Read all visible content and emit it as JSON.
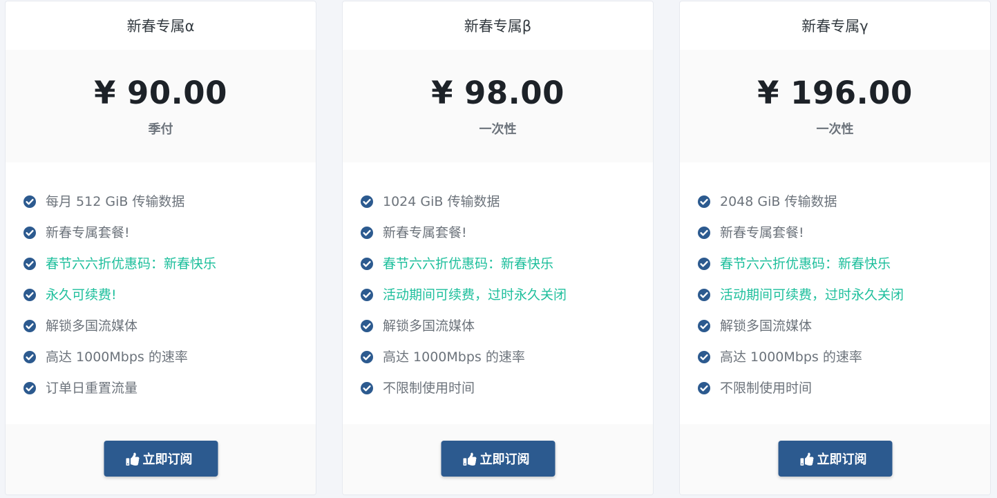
{
  "colors": {
    "accent": "#2c5a8f",
    "highlight": "#1ebf9c",
    "text_muted": "#6c737b",
    "price": "#1d2228"
  },
  "plans": [
    {
      "title": "新春专属α",
      "price": "¥ 90.00",
      "period": "季付",
      "features": [
        {
          "text": "每月 512 GiB 传输数据",
          "highlight": false
        },
        {
          "text": "新春专属套餐!",
          "highlight": false
        },
        {
          "text": "春节六六折优惠码：新春快乐",
          "highlight": true
        },
        {
          "text": "永久可续费!",
          "highlight": true
        },
        {
          "text": "解锁多国流媒体",
          "highlight": false
        },
        {
          "text": "高达 1000Mbps 的速率",
          "highlight": false
        },
        {
          "text": "订单日重置流量",
          "highlight": false
        }
      ],
      "button": {
        "label": "立即订阅",
        "icon": "thumbs-up-icon"
      }
    },
    {
      "title": "新春专属β",
      "price": "¥ 98.00",
      "period": "一次性",
      "features": [
        {
          "text": "1024 GiB 传输数据",
          "highlight": false
        },
        {
          "text": "新春专属套餐!",
          "highlight": false
        },
        {
          "text": "春节六六折优惠码：新春快乐",
          "highlight": true
        },
        {
          "text": "活动期间可续费，过时永久关闭",
          "highlight": true
        },
        {
          "text": "解锁多国流媒体",
          "highlight": false
        },
        {
          "text": "高达 1000Mbps 的速率",
          "highlight": false
        },
        {
          "text": "不限制使用时间",
          "highlight": false
        }
      ],
      "button": {
        "label": "立即订阅",
        "icon": "thumbs-up-icon"
      }
    },
    {
      "title": "新春专属γ",
      "price": "¥ 196.00",
      "period": "一次性",
      "features": [
        {
          "text": "2048 GiB 传输数据",
          "highlight": false
        },
        {
          "text": "新春专属套餐!",
          "highlight": false
        },
        {
          "text": "春节六六折优惠码：新春快乐",
          "highlight": true
        },
        {
          "text": "活动期间可续费，过时永久关闭",
          "highlight": true
        },
        {
          "text": "解锁多国流媒体",
          "highlight": false
        },
        {
          "text": "高达 1000Mbps 的速率",
          "highlight": false
        },
        {
          "text": "不限制使用时间",
          "highlight": false
        }
      ],
      "button": {
        "label": "立即订阅",
        "icon": "thumbs-up-icon"
      }
    }
  ]
}
